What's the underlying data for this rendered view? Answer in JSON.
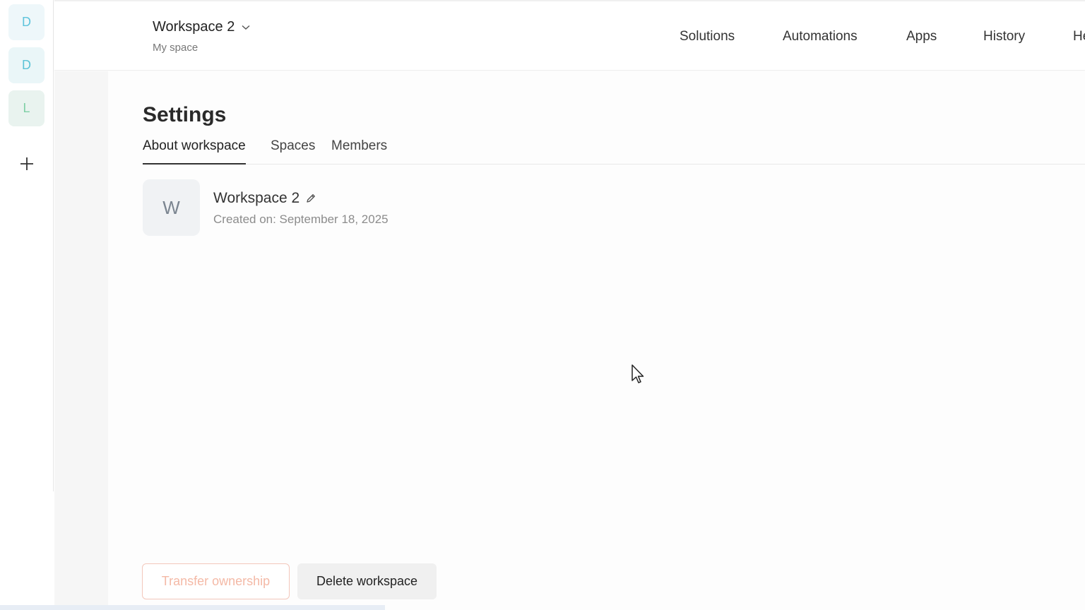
{
  "rail": {
    "workspaces": [
      {
        "initial": "D",
        "color": "#5fc4dc"
      },
      {
        "initial": "D",
        "color": "#5cc3d6"
      },
      {
        "initial": "L",
        "color": "#7fd0a6"
      }
    ],
    "add_icon": "plus-icon"
  },
  "header": {
    "workspace_name": "Workspace 2",
    "workspace_sub": "My space",
    "dropdown_icon": "chevron-down-icon",
    "nav": [
      "Solutions",
      "Automations",
      "Apps",
      "History",
      "He"
    ]
  },
  "settings": {
    "title": "Settings",
    "tabs": [
      "About workspace",
      "Spaces",
      "Members"
    ],
    "active_tab": "About workspace"
  },
  "workspace": {
    "avatar_initial": "W",
    "name": "Workspace 2",
    "edit_icon": "pencil-icon",
    "created": "Created on: September 18, 2025"
  },
  "actions": {
    "transfer_label": "Transfer ownership",
    "delete_label": "Delete workspace"
  },
  "colors": {
    "transfer_accent": "#f4b9a6"
  }
}
